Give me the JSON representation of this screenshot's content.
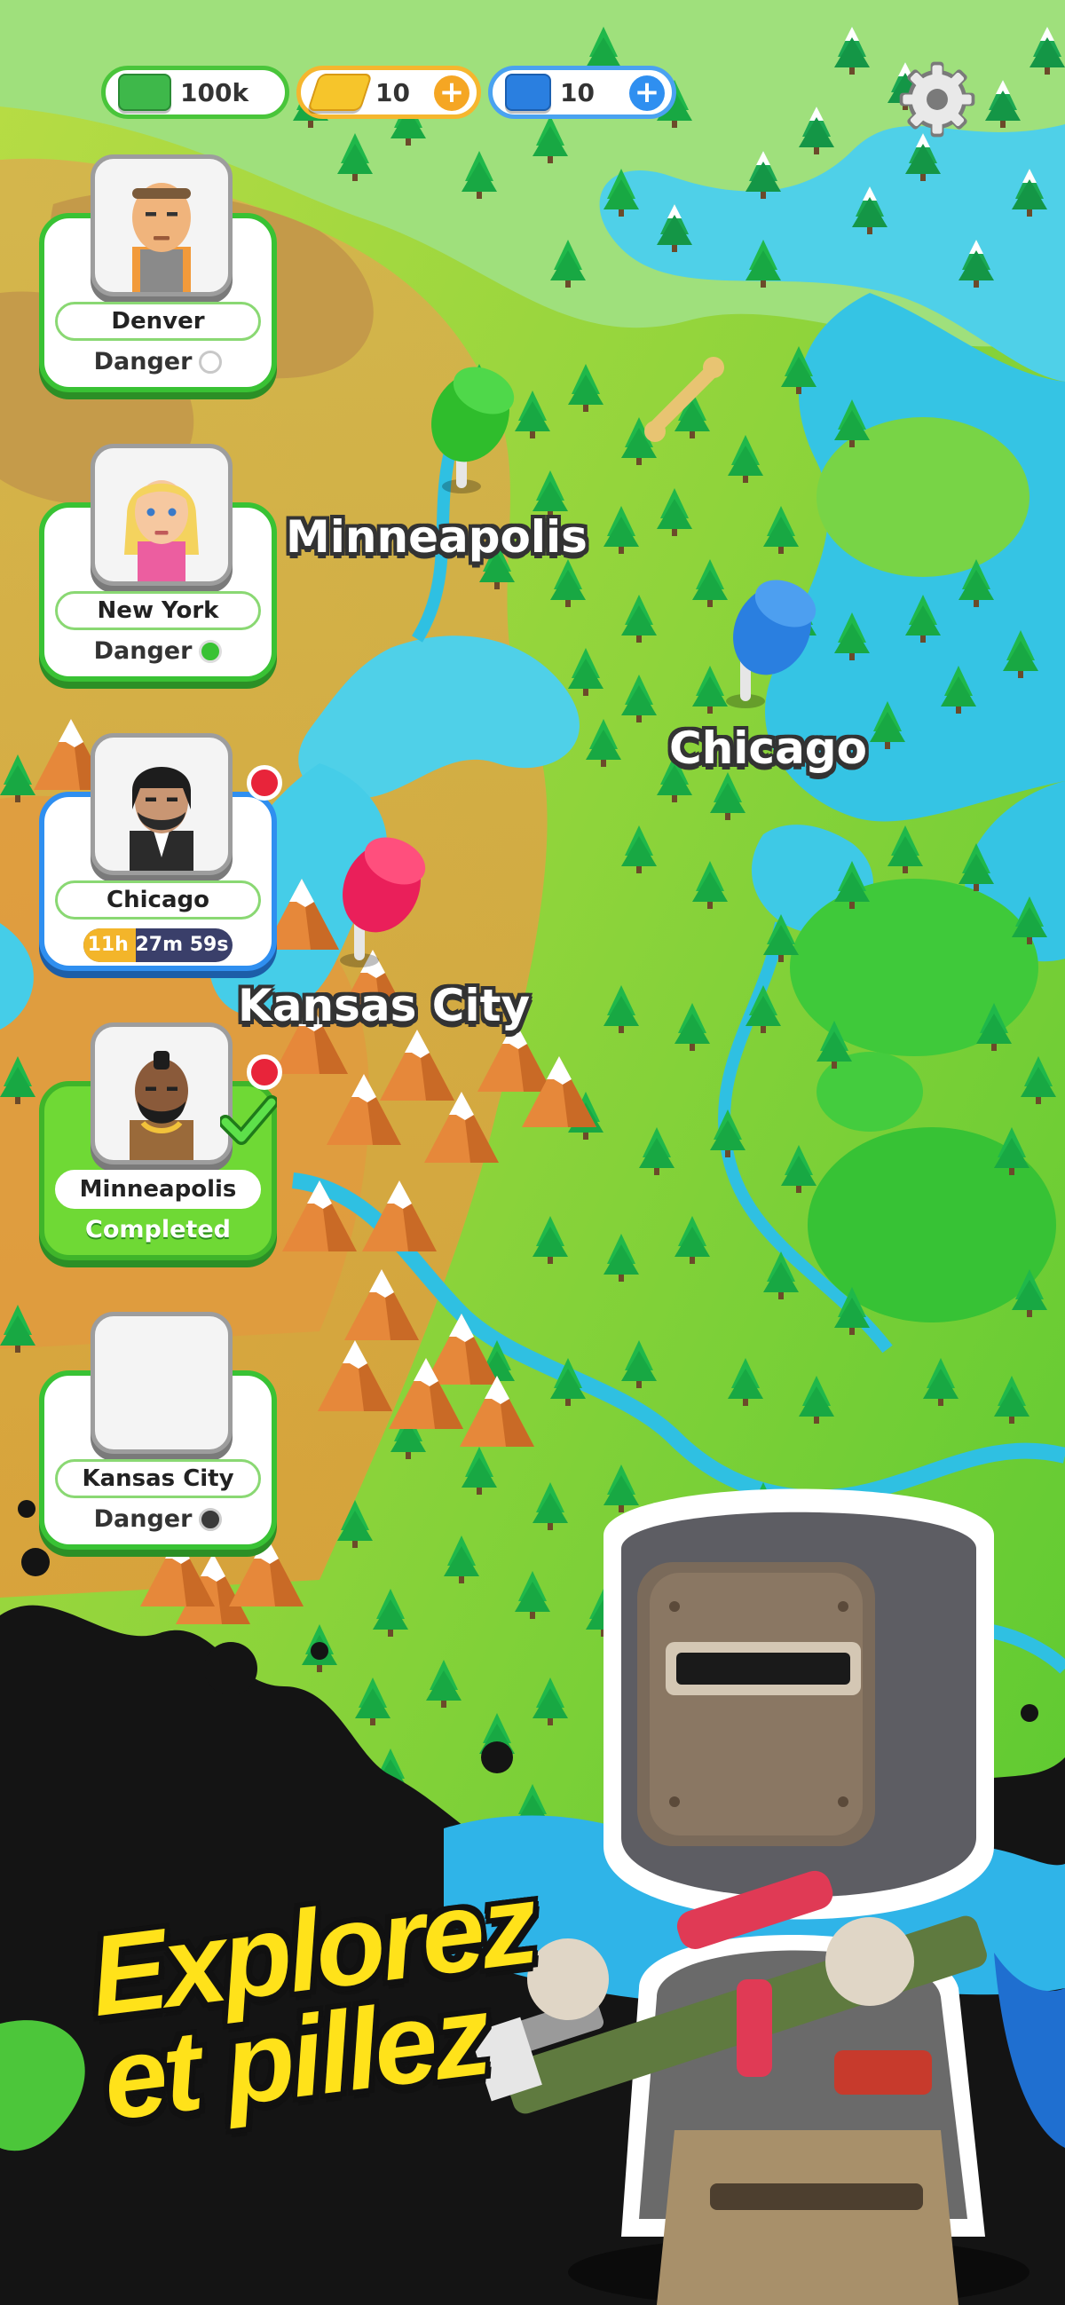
{
  "resources": {
    "cash": "100k",
    "gold": "10",
    "tickets": "10",
    "plus": "+"
  },
  "cities": [
    {
      "name": "Denver",
      "status": "Danger",
      "indicator": "empty"
    },
    {
      "name": "New York",
      "status": "Danger",
      "indicator": "green"
    },
    {
      "name": "Chicago",
      "timer": "11h 27m 59s",
      "timer_progress": 0.35
    },
    {
      "name": "Minneapolis",
      "status": "Completed"
    },
    {
      "name": "Kansas City",
      "status": "Danger",
      "indicator": "dark"
    }
  ],
  "map_labels": {
    "minneapolis": "Minneapolis",
    "chicago": "Chicago",
    "kansas_city": "Kansas City"
  },
  "promo": {
    "line1": "Explorez",
    "line2": "et pillez"
  },
  "colors": {
    "accent_green": "#39c234",
    "accent_blue": "#2f8ff0",
    "gold_plus": "#f5a623",
    "ticket_plus": "#2f8ff0",
    "badge_red": "#e8243a",
    "promo_yellow": "#ffe21a"
  },
  "icons": {
    "cash": "cash-icon",
    "gold": "gold-bar-icon",
    "tickets": "ticket-icon",
    "settings": "gear-icon"
  }
}
